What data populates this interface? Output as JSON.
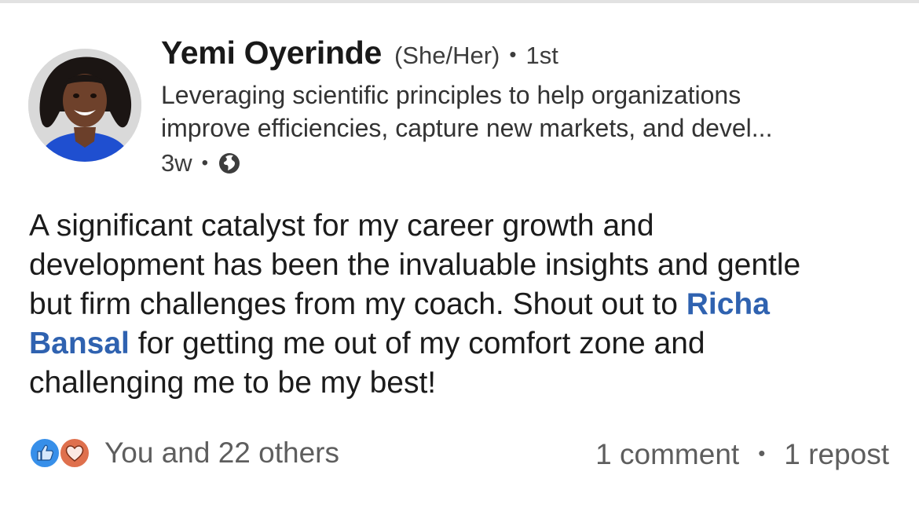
{
  "author": {
    "name": "Yemi Oyerinde",
    "pronouns": "(She/Her)",
    "separator": "•",
    "connection_degree": "1st",
    "headline_lines": [
      "Leveraging scientific principles to help organizations",
      "improve efficiencies, capture new markets, and devel..."
    ],
    "post_age": "3w",
    "visibility_icon": "globe-icon"
  },
  "post": {
    "lines": [
      {
        "text": "A significant catalyst for my career growth and"
      },
      {
        "text": "development has been the invaluable insights and gentle"
      },
      {
        "text": "but firm challenges from my coach. Shout out to ",
        "mention": "Richa"
      },
      {
        "mention": "Bansal",
        "text": " for getting me out of my comfort zone and"
      },
      {
        "text": "challenging me to be my best!"
      }
    ]
  },
  "social": {
    "reaction_icons": [
      "like-icon",
      "love-icon"
    ],
    "reactions_text": "You and 22 others",
    "comments": "1 comment",
    "separator": "•",
    "reposts": "1 repost"
  },
  "colors": {
    "mention": "#2f62b0",
    "like": "#378fe9",
    "love": "#df704d"
  }
}
